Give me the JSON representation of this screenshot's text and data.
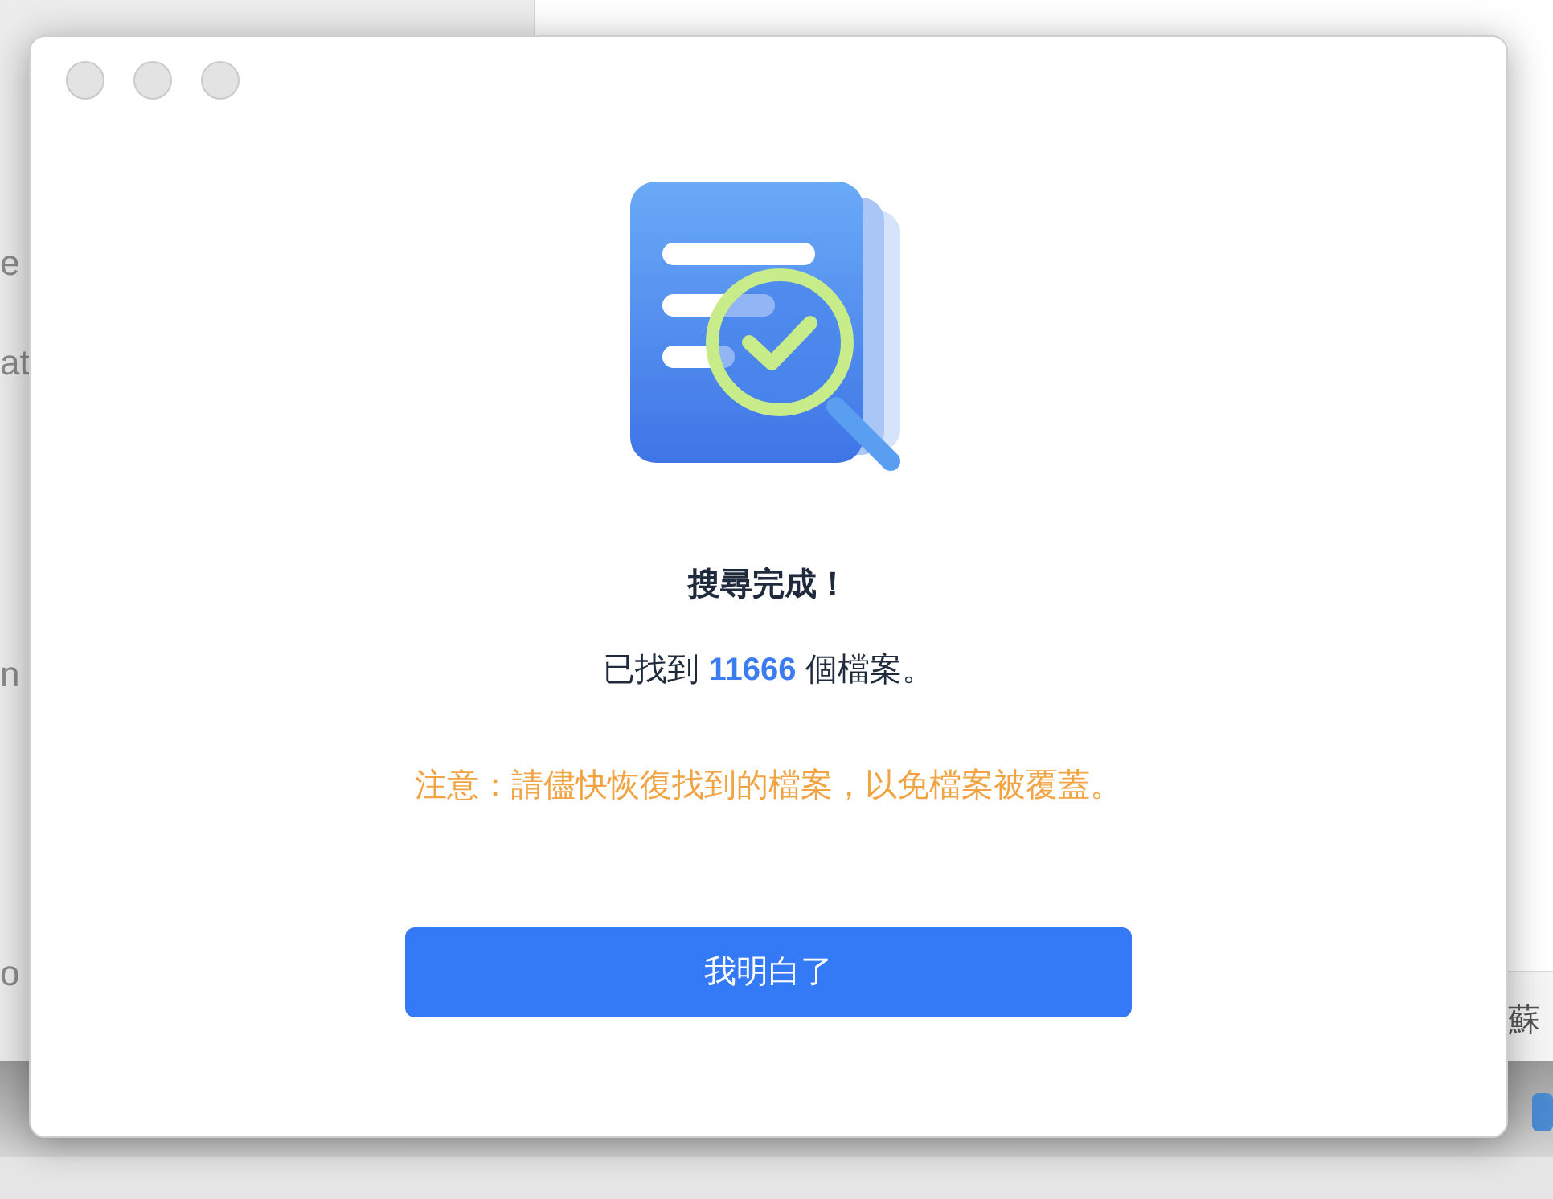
{
  "background": {
    "sidebar_fragments": [
      "e",
      "at",
      "n",
      "o"
    ],
    "panel_fragment": "蘇"
  },
  "dialog": {
    "heading": "搜尋完成！",
    "result": {
      "before": "已找到",
      "count": "11666",
      "after": "個檔案。"
    },
    "warning": "注意：請儘快恢復找到的檔案，以免檔案被覆蓋。",
    "button": "我明白了"
  }
}
